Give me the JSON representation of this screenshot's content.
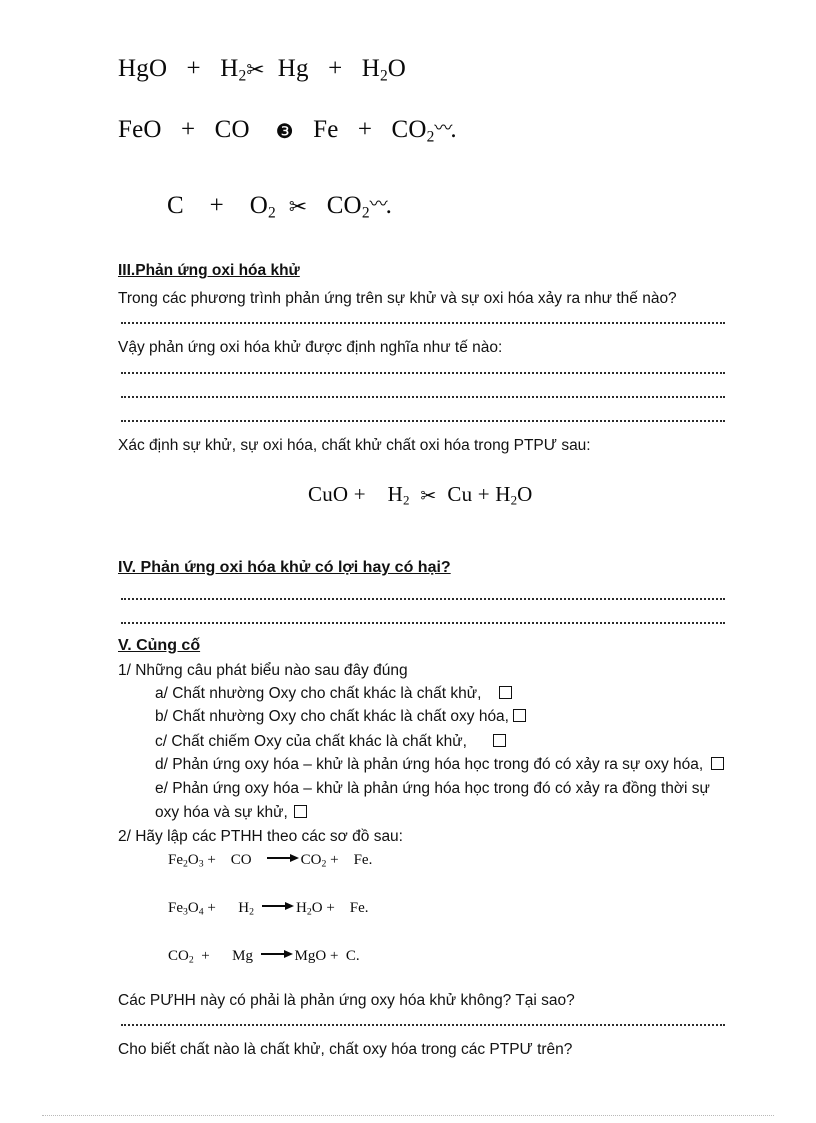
{
  "document": {
    "equations_top": [
      {
        "id": "eq-hgo",
        "left": "HgO   +   H",
        "left_sub": "2",
        "symbol": "✂",
        "symbol_name": "scissors-glyph",
        "right_a": "Hg   +   H",
        "right_sub": "2",
        "right_b": "O",
        "wave": "",
        "tail": ""
      },
      {
        "id": "eq-feo",
        "left": "FeO   +   CO",
        "left_sub": "",
        "symbol": "❸",
        "symbol_name": "circled-three-glyph",
        "right_a": "Fe   +   CO",
        "right_sub": "2",
        "right_b": "",
        "wave": "〰",
        "tail": "."
      },
      {
        "id": "eq-c-o2",
        "left": "C    +    O",
        "left_sub": "2",
        "symbol": "✂",
        "symbol_name": "scissors-glyph",
        "right_a": "CO",
        "right_sub": "2",
        "right_b": "",
        "wave": "〰",
        "tail": "."
      }
    ],
    "section_iii": {
      "heading": "III.Phản ứng oxi hóa khử",
      "q1": "Trong các phương trình phản ứng trên sự khử và sự oxi hóa xảy ra như thế nào?",
      "q2": "Vậy phản ứng oxi hóa khử được định nghĩa như tế nào:",
      "q3": "Xác định sự khử, sự oxi hóa, chất khử chất oxi hóa trong PTPƯ sau:"
    },
    "equation_cuo": {
      "left": "CuO +    H",
      "left_sub": "2",
      "symbol": "✂",
      "symbol_name": "scissors-glyph",
      "right_a": "Cu + H",
      "right_sub": "2",
      "right_b": "O"
    },
    "section_iv": {
      "heading": "IV. Phản ứng oxi hóa khử có lợi hay có hại?"
    },
    "section_v": {
      "heading": "V. Củng cố",
      "q1_label": "1/ Những câu phát biểu nào sau đây đúng",
      "choices": [
        {
          "id": "a",
          "text": "a/ Chất nhường Oxy cho chất khác là chất khử,"
        },
        {
          "id": "b",
          "text": "b/ Chất nhường Oxy cho chất khác là chất oxy hóa,"
        },
        {
          "id": "c",
          "text": "c/ Chất chiếm Oxy của chất khác là chất khử,"
        },
        {
          "id": "d",
          "text": "d/ Phản ứng oxy hóa – khử là phản ứng hóa học trong đó có xảy ra sự oxy hóa,"
        },
        {
          "id": "e",
          "text": "e/ Phản ứng oxy hóa – khử là phản ứng hóa học trong đó có xảy ra đồng thời sự"
        },
        {
          "id": "e2",
          "text": "oxy hóa và sự khử,"
        }
      ],
      "q2_label": "2/ Hãy lập các PTHH theo các sơ đồ sau:",
      "equations": [
        {
          "id": "eq-fe2o3",
          "a": "Fe",
          "a_sub": "2",
          "a2": "O",
          "a2_sub": "3",
          "plus1": " +    CO    ",
          "b": "CO",
          "b_sub": "2",
          "tail": " +    Fe."
        },
        {
          "id": "eq-fe3o4",
          "a": "Fe",
          "a_sub": "3",
          "a2": "O",
          "a2_sub": "4",
          "plus1": " +      H",
          "plus1_sub": "2",
          "b": "H",
          "b_sub": "2",
          "b2": "O",
          "tail": " +    Fe."
        },
        {
          "id": "eq-co2-mg",
          "a": "CO",
          "a_sub": "2",
          "plus1": "  +      Mg  ",
          "b": "MgO",
          "b_sub": "",
          "tail": " +  C."
        }
      ],
      "q3": "Các PƯHH này có phải là phản ứng oxy hóa khử không? Tại sao?",
      "q4": "Cho biết chất nào là chất khử, chất oxy hóa trong các PTPƯ trên?"
    }
  }
}
